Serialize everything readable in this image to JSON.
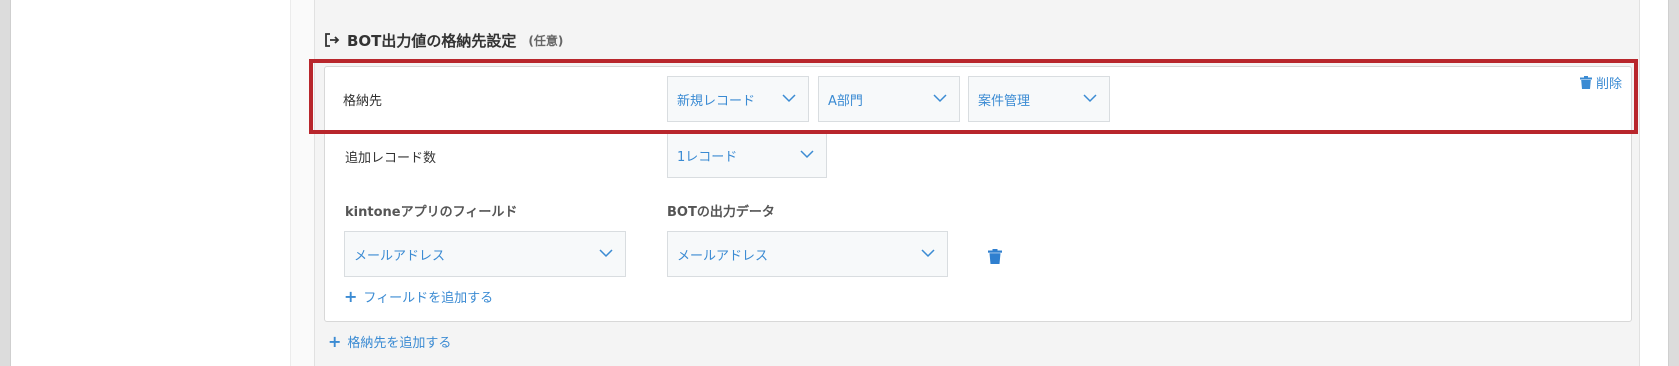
{
  "section": {
    "title": "BOT出力値の格納先設定",
    "optional": "(任意)"
  },
  "storage": {
    "delete_label": "削除",
    "destination_label": "格納先",
    "destination_values": [
      "新規レコード",
      "A部門",
      "案件管理"
    ],
    "record_count_label": "追加レコード数",
    "record_count_value": "1レコード",
    "kintone_field_header": "kintoneアプリのフィールド",
    "bot_output_header": "BOTの出力データ",
    "mapping": {
      "kintone_field": "メールアドレス",
      "bot_output": "メールアドレス"
    },
    "add_field_label": "フィールドを追加する"
  },
  "add_destination_label": "格納先を追加する",
  "colors": {
    "accent": "#3b8bd3",
    "highlight": "#b8262c"
  }
}
